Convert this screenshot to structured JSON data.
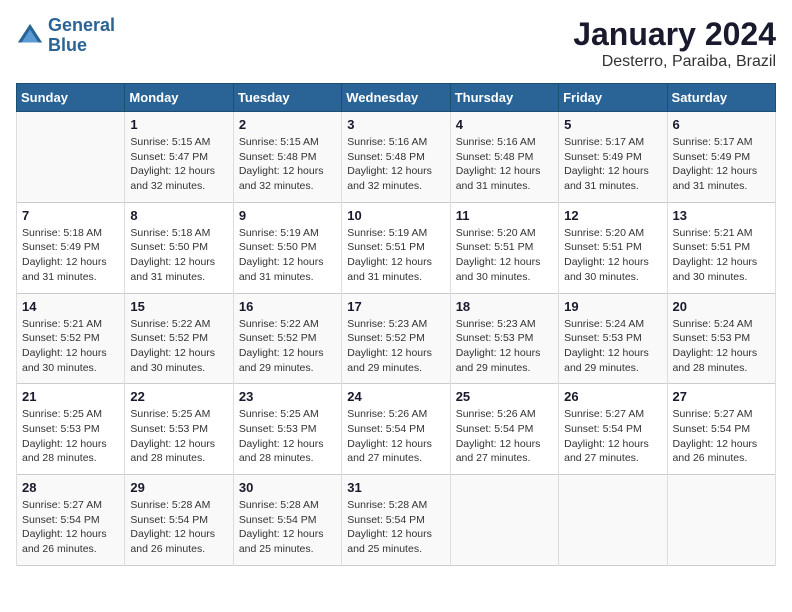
{
  "header": {
    "logo_line1": "General",
    "logo_line2": "Blue",
    "title": "January 2024",
    "subtitle": "Desterro, Paraiba, Brazil"
  },
  "days_of_week": [
    "Sunday",
    "Monday",
    "Tuesday",
    "Wednesday",
    "Thursday",
    "Friday",
    "Saturday"
  ],
  "weeks": [
    [
      {
        "day": "",
        "info": ""
      },
      {
        "day": "1",
        "info": "Sunrise: 5:15 AM\nSunset: 5:47 PM\nDaylight: 12 hours\nand 32 minutes."
      },
      {
        "day": "2",
        "info": "Sunrise: 5:15 AM\nSunset: 5:48 PM\nDaylight: 12 hours\nand 32 minutes."
      },
      {
        "day": "3",
        "info": "Sunrise: 5:16 AM\nSunset: 5:48 PM\nDaylight: 12 hours\nand 32 minutes."
      },
      {
        "day": "4",
        "info": "Sunrise: 5:16 AM\nSunset: 5:48 PM\nDaylight: 12 hours\nand 31 minutes."
      },
      {
        "day": "5",
        "info": "Sunrise: 5:17 AM\nSunset: 5:49 PM\nDaylight: 12 hours\nand 31 minutes."
      },
      {
        "day": "6",
        "info": "Sunrise: 5:17 AM\nSunset: 5:49 PM\nDaylight: 12 hours\nand 31 minutes."
      }
    ],
    [
      {
        "day": "7",
        "info": "Sunrise: 5:18 AM\nSunset: 5:49 PM\nDaylight: 12 hours\nand 31 minutes."
      },
      {
        "day": "8",
        "info": "Sunrise: 5:18 AM\nSunset: 5:50 PM\nDaylight: 12 hours\nand 31 minutes."
      },
      {
        "day": "9",
        "info": "Sunrise: 5:19 AM\nSunset: 5:50 PM\nDaylight: 12 hours\nand 31 minutes."
      },
      {
        "day": "10",
        "info": "Sunrise: 5:19 AM\nSunset: 5:51 PM\nDaylight: 12 hours\nand 31 minutes."
      },
      {
        "day": "11",
        "info": "Sunrise: 5:20 AM\nSunset: 5:51 PM\nDaylight: 12 hours\nand 30 minutes."
      },
      {
        "day": "12",
        "info": "Sunrise: 5:20 AM\nSunset: 5:51 PM\nDaylight: 12 hours\nand 30 minutes."
      },
      {
        "day": "13",
        "info": "Sunrise: 5:21 AM\nSunset: 5:51 PM\nDaylight: 12 hours\nand 30 minutes."
      }
    ],
    [
      {
        "day": "14",
        "info": "Sunrise: 5:21 AM\nSunset: 5:52 PM\nDaylight: 12 hours\nand 30 minutes."
      },
      {
        "day": "15",
        "info": "Sunrise: 5:22 AM\nSunset: 5:52 PM\nDaylight: 12 hours\nand 30 minutes."
      },
      {
        "day": "16",
        "info": "Sunrise: 5:22 AM\nSunset: 5:52 PM\nDaylight: 12 hours\nand 29 minutes."
      },
      {
        "day": "17",
        "info": "Sunrise: 5:23 AM\nSunset: 5:52 PM\nDaylight: 12 hours\nand 29 minutes."
      },
      {
        "day": "18",
        "info": "Sunrise: 5:23 AM\nSunset: 5:53 PM\nDaylight: 12 hours\nand 29 minutes."
      },
      {
        "day": "19",
        "info": "Sunrise: 5:24 AM\nSunset: 5:53 PM\nDaylight: 12 hours\nand 29 minutes."
      },
      {
        "day": "20",
        "info": "Sunrise: 5:24 AM\nSunset: 5:53 PM\nDaylight: 12 hours\nand 28 minutes."
      }
    ],
    [
      {
        "day": "21",
        "info": "Sunrise: 5:25 AM\nSunset: 5:53 PM\nDaylight: 12 hours\nand 28 minutes."
      },
      {
        "day": "22",
        "info": "Sunrise: 5:25 AM\nSunset: 5:53 PM\nDaylight: 12 hours\nand 28 minutes."
      },
      {
        "day": "23",
        "info": "Sunrise: 5:25 AM\nSunset: 5:53 PM\nDaylight: 12 hours\nand 28 minutes."
      },
      {
        "day": "24",
        "info": "Sunrise: 5:26 AM\nSunset: 5:54 PM\nDaylight: 12 hours\nand 27 minutes."
      },
      {
        "day": "25",
        "info": "Sunrise: 5:26 AM\nSunset: 5:54 PM\nDaylight: 12 hours\nand 27 minutes."
      },
      {
        "day": "26",
        "info": "Sunrise: 5:27 AM\nSunset: 5:54 PM\nDaylight: 12 hours\nand 27 minutes."
      },
      {
        "day": "27",
        "info": "Sunrise: 5:27 AM\nSunset: 5:54 PM\nDaylight: 12 hours\nand 26 minutes."
      }
    ],
    [
      {
        "day": "28",
        "info": "Sunrise: 5:27 AM\nSunset: 5:54 PM\nDaylight: 12 hours\nand 26 minutes."
      },
      {
        "day": "29",
        "info": "Sunrise: 5:28 AM\nSunset: 5:54 PM\nDaylight: 12 hours\nand 26 minutes."
      },
      {
        "day": "30",
        "info": "Sunrise: 5:28 AM\nSunset: 5:54 PM\nDaylight: 12 hours\nand 25 minutes."
      },
      {
        "day": "31",
        "info": "Sunrise: 5:28 AM\nSunset: 5:54 PM\nDaylight: 12 hours\nand 25 minutes."
      },
      {
        "day": "",
        "info": ""
      },
      {
        "day": "",
        "info": ""
      },
      {
        "day": "",
        "info": ""
      }
    ]
  ]
}
